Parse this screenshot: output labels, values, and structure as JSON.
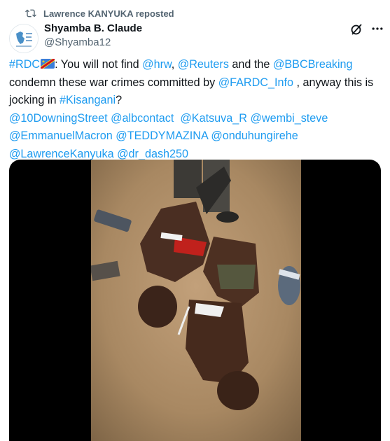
{
  "repost": {
    "text": "Lawrence KANYUKA reposted",
    "icon": "repost-icon"
  },
  "author": {
    "name": "Shyamba B. Claude",
    "handle": "@Shyamba12"
  },
  "colors": {
    "link": "#1d9bf0",
    "secondary": "#536471",
    "text": "#0f1419"
  },
  "tweet": {
    "hashtag_rdc": "#RDC",
    "t1": ": You will not find ",
    "m_hrw": "@hrw",
    "c1": ", ",
    "m_reuters": "@Reuters",
    "t2": " and the ",
    "m_bbc": "@BBCBreaking",
    "t3": " condemn these war crimes committed by ",
    "m_fardc": "@FARDC_Info",
    "t4": " , anyway this is jocking in ",
    "hashtag_kis": "#Kisangani",
    "t5": "?",
    "mentions_line1": [
      "@10DowningStreet",
      "@albcontact",
      "@Katsuva_R",
      "@wembi_steve"
    ],
    "mentions_line2": [
      "@EmmanuelMacron",
      "@TEDDYMAZINA",
      "@onduhungirehe"
    ],
    "mentions_line3": [
      "@LawrenceKanyuka",
      "@dr_dash250"
    ]
  }
}
